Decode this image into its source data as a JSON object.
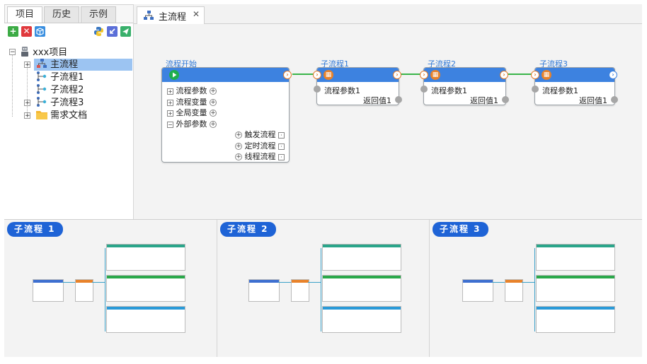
{
  "left_tabs": [
    "项目",
    "历史",
    "示例"
  ],
  "left_active_tab": 0,
  "toolbar": {
    "add": "+",
    "remove": "✕"
  },
  "tree": {
    "root": "xxx项目",
    "items": [
      {
        "label": "主流程",
        "selected": true
      },
      {
        "label": "子流程1"
      },
      {
        "label": "子流程2"
      },
      {
        "label": "子流程3"
      },
      {
        "label": "需求文档"
      }
    ]
  },
  "doc_tab": {
    "label": "主流程",
    "close": "✕"
  },
  "start_node": {
    "title": "流程开始",
    "rows_left": [
      "流程参数",
      "流程变量",
      "全局变量",
      "外部参数"
    ],
    "rows_right": [
      "触发流程",
      "定时流程",
      "线程流程"
    ]
  },
  "sub_nodes": [
    {
      "title": "子流程1",
      "param": "流程参数1",
      "ret": "返回值1"
    },
    {
      "title": "子流程2",
      "param": "流程参数1",
      "ret": "返回值1"
    },
    {
      "title": "子流程3",
      "param": "流程参数1",
      "ret": "返回值1"
    }
  ],
  "thumbnails": [
    "子流程 1",
    "子流程 2",
    "子流程 3"
  ],
  "colors": {
    "accent": "#3d82e0",
    "wire": "#39b54a",
    "port_out": "#e07a2b",
    "thumb_label": "#1e63d6"
  }
}
